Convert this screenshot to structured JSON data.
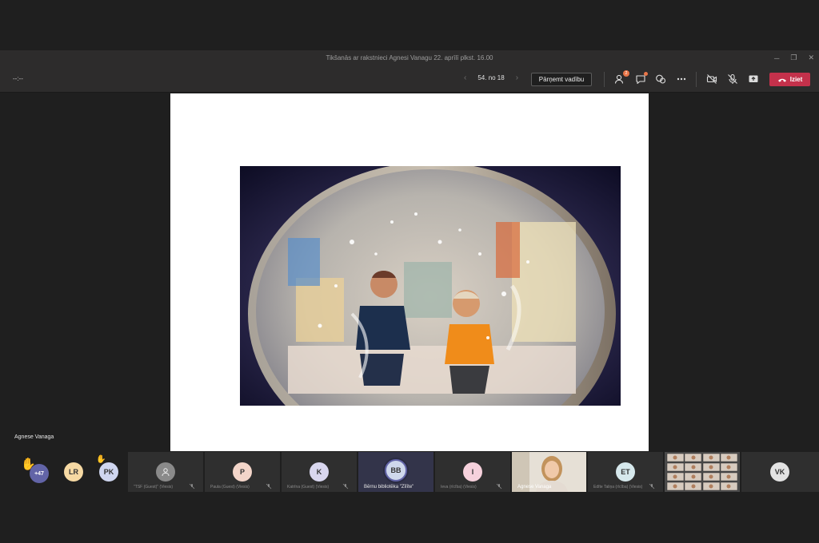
{
  "window": {
    "title": "Tikšanās ar rakstnieci Agnesi Vanagu 22. aprīlī plkst. 16.00",
    "controls": [
      "─",
      "❐",
      "✕"
    ]
  },
  "toolbar": {
    "timer": "--:--",
    "pager_text": "54. no 18",
    "take_control_label": "Pārņemt vadību",
    "participants_badge": "2",
    "leave_label": "Iziet"
  },
  "stage": {
    "presenter_name": "Agnese Vanaga"
  },
  "participants": {
    "overflow_count": "+47",
    "tiles": [
      {
        "initials": "LR"
      },
      {
        "initials": "PK"
      },
      {
        "initials": "",
        "name": "\"TSF (Guest)\" (Viesis)"
      },
      {
        "initials": "P",
        "name": "Paula (Guest) (Viesis)"
      },
      {
        "initials": "K",
        "name": "Katrīna (Guest) (Viesis)"
      },
      {
        "initials": "BB",
        "name": "Bērnu bibliotēka \"Zīlīte\""
      },
      {
        "initials": "I",
        "name": "Ieva (rīcība) (Viesis)"
      },
      {
        "initials": "",
        "name": "Agnese Vanaga"
      },
      {
        "initials": "ET",
        "name": "Edīte Taliņa (rīcība) (Viesis)"
      },
      {
        "initials": "VK"
      }
    ]
  },
  "colors": {
    "accent_leave": "#c4314b",
    "badge": "#e97548",
    "speaker_ring": "#6264a7"
  }
}
